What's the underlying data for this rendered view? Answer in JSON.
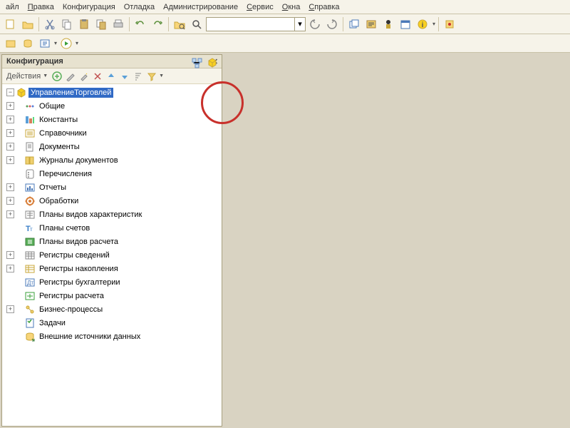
{
  "menubar": {
    "items": [
      {
        "label": "айл",
        "u": ""
      },
      {
        "label": "равка",
        "u": "П"
      },
      {
        "label": "Конфигурация",
        "u": ""
      },
      {
        "label": "Отладка",
        "u": ""
      },
      {
        "label": "Администрирование",
        "u": ""
      },
      {
        "label": "ервис",
        "u": "С"
      },
      {
        "label": "кна",
        "u": "О"
      },
      {
        "label": "правка",
        "u": "С"
      }
    ]
  },
  "toolbar": {
    "search_value": ""
  },
  "panel": {
    "title": "Конфигурация",
    "actions_label": "Действия"
  },
  "tree": {
    "root": {
      "label": "УправлениеТорговлей",
      "selected": true
    },
    "items": [
      {
        "label": "Общие",
        "icon": "dots",
        "exp": "+"
      },
      {
        "label": "Константы",
        "icon": "constants",
        "exp": "+"
      },
      {
        "label": "Справочники",
        "icon": "catalog",
        "exp": "+"
      },
      {
        "label": "Документы",
        "icon": "documents",
        "exp": "+"
      },
      {
        "label": "Журналы документов",
        "icon": "journals",
        "exp": "+"
      },
      {
        "label": "Перечисления",
        "icon": "enums",
        "exp": " "
      },
      {
        "label": "Отчеты",
        "icon": "reports",
        "exp": "+"
      },
      {
        "label": "Обработки",
        "icon": "processing",
        "exp": "+"
      },
      {
        "label": "Планы видов характеристик",
        "icon": "chartypes",
        "exp": "+"
      },
      {
        "label": "Планы счетов",
        "icon": "accounts",
        "exp": " "
      },
      {
        "label": "Планы видов расчета",
        "icon": "calctypes",
        "exp": " "
      },
      {
        "label": "Регистры сведений",
        "icon": "inforeg",
        "exp": "+"
      },
      {
        "label": "Регистры накопления",
        "icon": "accumreg",
        "exp": "+"
      },
      {
        "label": "Регистры бухгалтерии",
        "icon": "accreg",
        "exp": " "
      },
      {
        "label": "Регистры расчета",
        "icon": "calcreg",
        "exp": " "
      },
      {
        "label": "Бизнес-процессы",
        "icon": "bprocess",
        "exp": "+"
      },
      {
        "label": "Задачи",
        "icon": "tasks",
        "exp": " "
      },
      {
        "label": "Внешние источники данных",
        "icon": "external",
        "exp": " "
      }
    ]
  }
}
